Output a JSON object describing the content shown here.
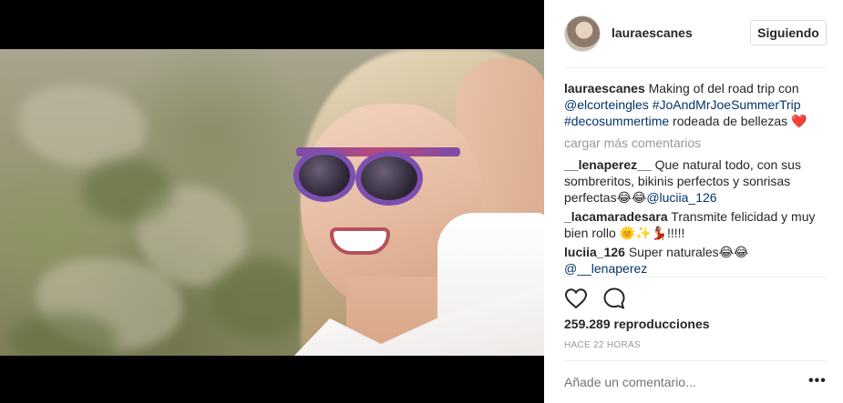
{
  "post": {
    "media_type": "video"
  },
  "header": {
    "username": "lauraescanes",
    "follow_label": "Siguiendo"
  },
  "caption": {
    "user": "lauraescanes",
    "text_1": "Making of del road trip con ",
    "mention": "@elcorteingles",
    "hashtag_1": "#JoAndMrJoeSummerTrip",
    "hashtag_2": "#decosummertime",
    "text_2": " rodeada de bellezas ",
    "emoji": "❤️"
  },
  "load_more_label": "cargar más comentarios",
  "comments": [
    {
      "user": "__lenaperez__",
      "text": "Que natural todo, con sus sombreritos, bikinis perfectos y sonrisas perfectas😂😂",
      "mention": "@luciia_126"
    },
    {
      "user": "_lacamaradesara",
      "text": "Transmite felicidad y muy bien rollo 🌞✨💃🏽!!!!!"
    },
    {
      "user": "luciia_126",
      "text": "Super naturales😂😂",
      "mention_line": "@__lenaperez"
    }
  ],
  "icons": {
    "like": "heart-icon",
    "comment": "comment-icon"
  },
  "stats": {
    "views_text": "259.289 reproducciones",
    "timestamp": "HACE 22 HORAS"
  },
  "add_comment": {
    "placeholder": "Añade un comentario...",
    "more_label": "•••"
  }
}
